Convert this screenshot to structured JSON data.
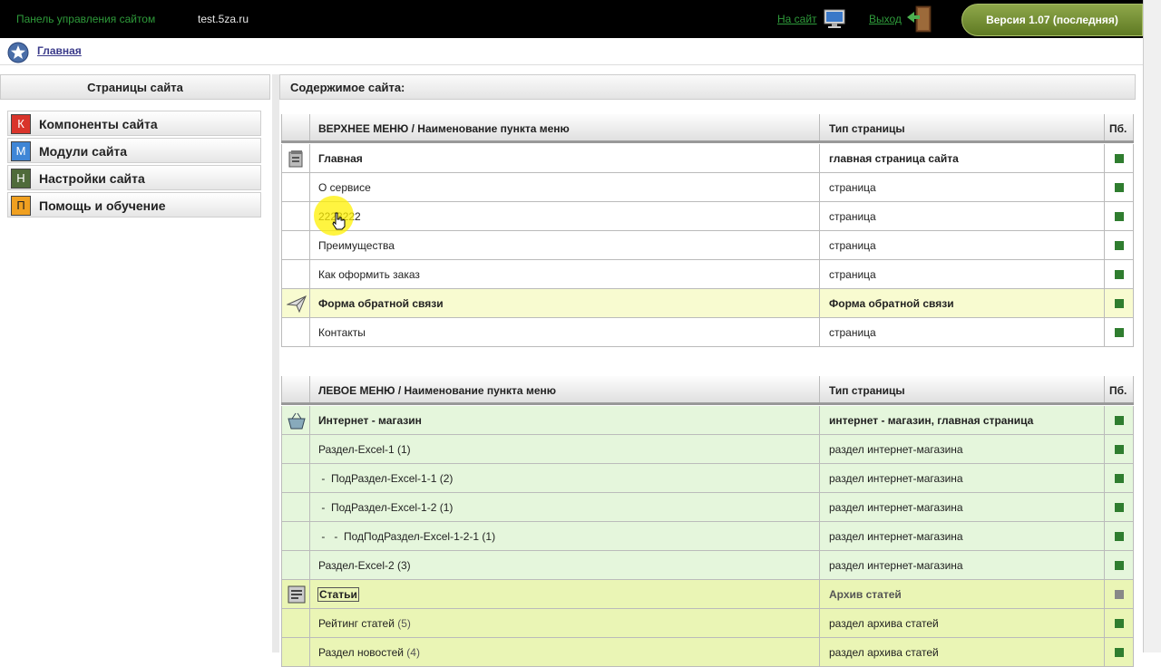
{
  "topbar": {
    "panel_title": "Панель управления сайтом",
    "domain": "test.5za.ru",
    "to_site": "На сайт",
    "exit": "Выход",
    "version": "Версия 1.07 (последняя)"
  },
  "breadcrumb": {
    "home": "Главная"
  },
  "sidebar": {
    "title": "Страницы сайта",
    "items": [
      {
        "letter": "К",
        "label": "Компоненты сайта",
        "color": "#d9342b"
      },
      {
        "letter": "М",
        "label": "Модули сайта",
        "color": "#3f86d6"
      },
      {
        "letter": "Н",
        "label": "Настройки сайта",
        "color": "#4f6b3a"
      },
      {
        "letter": "П",
        "label": "Помощь и обучение",
        "color": "#f0a020"
      }
    ]
  },
  "content": {
    "title": "Содержимое сайта:",
    "top_menu": {
      "col_name": "ВЕРХНЕЕ МЕНЮ / Наименование пункта меню",
      "col_type": "Тип страницы",
      "col_pub": "Пб.",
      "rows": [
        {
          "name": "Главная",
          "type": "главная страница сайта"
        },
        {
          "name": "О сервисе",
          "type": "страница"
        },
        {
          "name": "2223222",
          "type": "страница"
        },
        {
          "name": "Преимущества",
          "type": "страница"
        },
        {
          "name": "Как оформить заказ",
          "type": "страница"
        },
        {
          "name": "Форма обратной связи",
          "type": "Форма обратной связи"
        },
        {
          "name": "Контакты",
          "type": "страница"
        }
      ]
    },
    "left_menu": {
      "col_name": "ЛЕВОЕ МЕНЮ / Наименование пункта меню",
      "col_type": "Тип страницы",
      "col_pub": "Пб.",
      "rows": [
        {
          "name": "Интернет - магазин",
          "type": "интернет - магазин, главная страница"
        },
        {
          "name": "Раздел-Excel-1 (1)",
          "type": "раздел интернет-магазина"
        },
        {
          "name": " -  ПодРаздел-Excel-1-1 (2)",
          "type": "раздел интернет-магазина"
        },
        {
          "name": " -  ПодРаздел-Excel-1-2 (1)",
          "type": "раздел интернет-магазина"
        },
        {
          "name": " -   -  ПодПодРаздел-Excel-1-2-1 (1)",
          "type": "раздел интернет-магазина"
        },
        {
          "name": "Раздел-Excel-2 (3)",
          "type": "раздел интернет-магазина"
        },
        {
          "name": "Статьи",
          "type": "Архив статей"
        },
        {
          "name": "Рейтинг статей",
          "count": "(5)",
          "type": "раздел архива статей"
        },
        {
          "name": "Раздел новостей",
          "count": "(4)",
          "type": "раздел архива статей"
        }
      ]
    }
  }
}
